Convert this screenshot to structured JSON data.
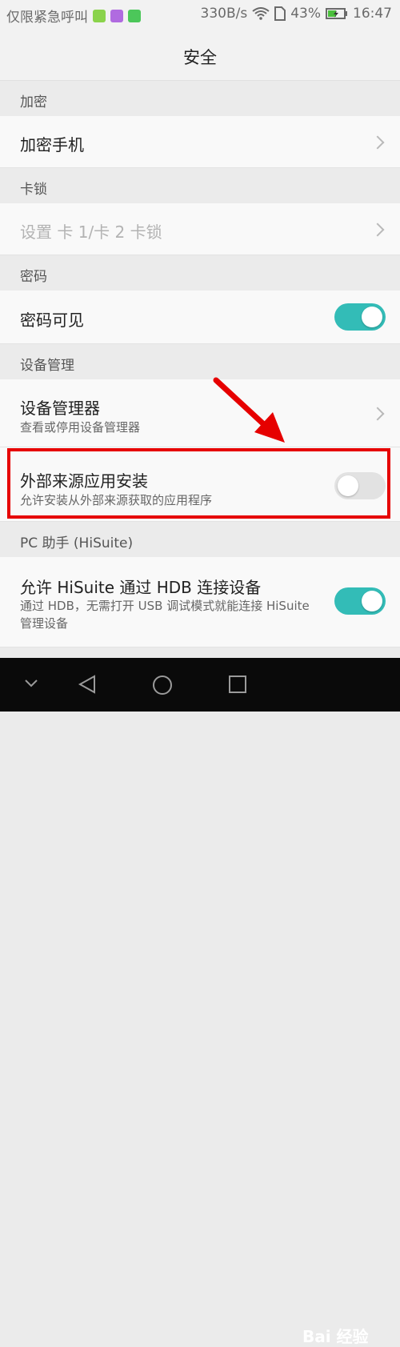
{
  "status_bar": {
    "carrier": "仅限紧急呼叫",
    "net_speed": "330B/s",
    "battery": "43%",
    "time": "16:47"
  },
  "header": {
    "title": "安全"
  },
  "sections": {
    "encrypt": "加密",
    "sim_lock": "卡锁",
    "password": "密码",
    "device_mgmt": "设备管理",
    "pc_assistant": "PC 助手 (HiSuite)"
  },
  "rows": {
    "encrypt_phone": {
      "title": "加密手机"
    },
    "sim_lock": {
      "title": "设置 卡 1/卡 2 卡锁"
    },
    "password_visible": {
      "title": "密码可见",
      "enabled": true
    },
    "device_admins": {
      "title": "设备管理器",
      "subtitle": "查看或停用设备管理器"
    },
    "unknown_sources": {
      "title": "外部来源应用安装",
      "subtitle": "允许安装从外部来源获取的应用程序",
      "enabled": false
    },
    "hisuite": {
      "title": "允许 HiSuite 通过 HDB 连接设备",
      "subtitle_line1": "通过 HDB，无需打开 USB 调试模式就能连接 HiSuite",
      "subtitle_line2": "管理设备",
      "enabled": true
    }
  },
  "watermark": "Bai 经验",
  "colors": {
    "toggle_on": "#33bcb7",
    "highlight": "#e60000",
    "arrow": "#e60000"
  }
}
